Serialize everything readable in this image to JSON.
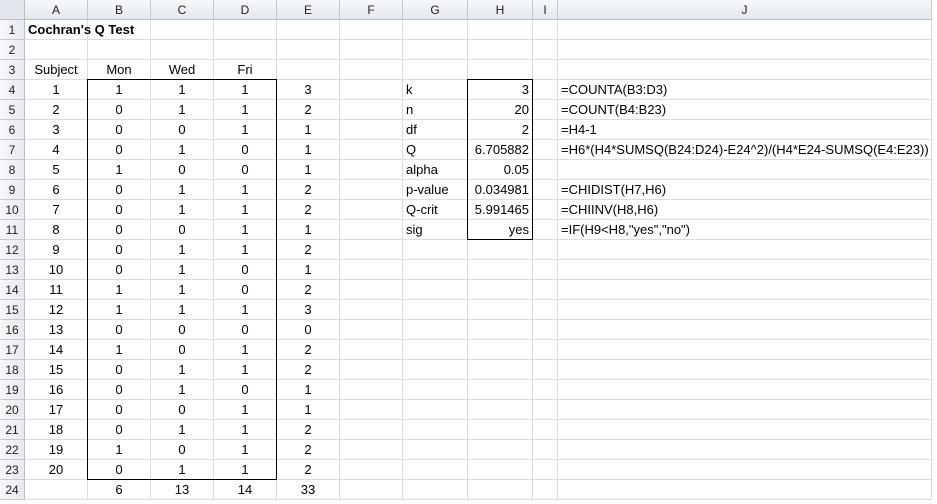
{
  "columns": [
    "A",
    "B",
    "C",
    "D",
    "E",
    "F",
    "G",
    "H",
    "I",
    "J"
  ],
  "rows": [
    "1",
    "2",
    "3",
    "4",
    "5",
    "6",
    "7",
    "8",
    "9",
    "10",
    "11",
    "12",
    "13",
    "14",
    "15",
    "16",
    "17",
    "18",
    "19",
    "20",
    "21",
    "22",
    "23",
    "24"
  ],
  "title": "Cochran's Q Test",
  "headers": {
    "subject": "Subject",
    "mon": "Mon",
    "wed": "Wed",
    "fri": "Fri"
  },
  "data_rows": [
    [
      "1",
      "1",
      "1",
      "1",
      "3"
    ],
    [
      "2",
      "0",
      "1",
      "1",
      "2"
    ],
    [
      "3",
      "0",
      "0",
      "1",
      "1"
    ],
    [
      "4",
      "0",
      "1",
      "0",
      "1"
    ],
    [
      "5",
      "1",
      "0",
      "0",
      "1"
    ],
    [
      "6",
      "0",
      "1",
      "1",
      "2"
    ],
    [
      "7",
      "0",
      "1",
      "1",
      "2"
    ],
    [
      "8",
      "0",
      "0",
      "1",
      "1"
    ],
    [
      "9",
      "0",
      "1",
      "1",
      "2"
    ],
    [
      "10",
      "0",
      "1",
      "0",
      "1"
    ],
    [
      "11",
      "1",
      "1",
      "0",
      "2"
    ],
    [
      "12",
      "1",
      "1",
      "1",
      "3"
    ],
    [
      "13",
      "0",
      "0",
      "0",
      "0"
    ],
    [
      "14",
      "1",
      "0",
      "1",
      "2"
    ],
    [
      "15",
      "0",
      "1",
      "1",
      "2"
    ],
    [
      "16",
      "0",
      "1",
      "0",
      "1"
    ],
    [
      "17",
      "0",
      "0",
      "1",
      "1"
    ],
    [
      "18",
      "0",
      "1",
      "1",
      "2"
    ],
    [
      "19",
      "1",
      "0",
      "1",
      "2"
    ],
    [
      "20",
      "0",
      "1",
      "1",
      "2"
    ]
  ],
  "totals": [
    "6",
    "13",
    "14",
    "33"
  ],
  "stats": [
    {
      "label": "k",
      "value": "3",
      "formula": "=COUNTA(B3:D3)"
    },
    {
      "label": "n",
      "value": "20",
      "formula": "=COUNT(B4:B23)"
    },
    {
      "label": "df",
      "value": "2",
      "formula": "=H4-1"
    },
    {
      "label": "Q",
      "value": "6.705882",
      "formula": "=H6*(H4*SUMSQ(B24:D24)-E24^2)/(H4*E24-SUMSQ(E4:E23))"
    },
    {
      "label": "alpha",
      "value": "0.05",
      "formula": ""
    },
    {
      "label": "p-value",
      "value": "0.034981",
      "formula": "=CHIDIST(H7,H6)"
    },
    {
      "label": "Q-crit",
      "value": "5.991465",
      "formula": "=CHIINV(H8,H6)"
    },
    {
      "label": "sig",
      "value": "yes",
      "formula": "=IF(H9<H8,\"yes\",\"no\")"
    }
  ]
}
